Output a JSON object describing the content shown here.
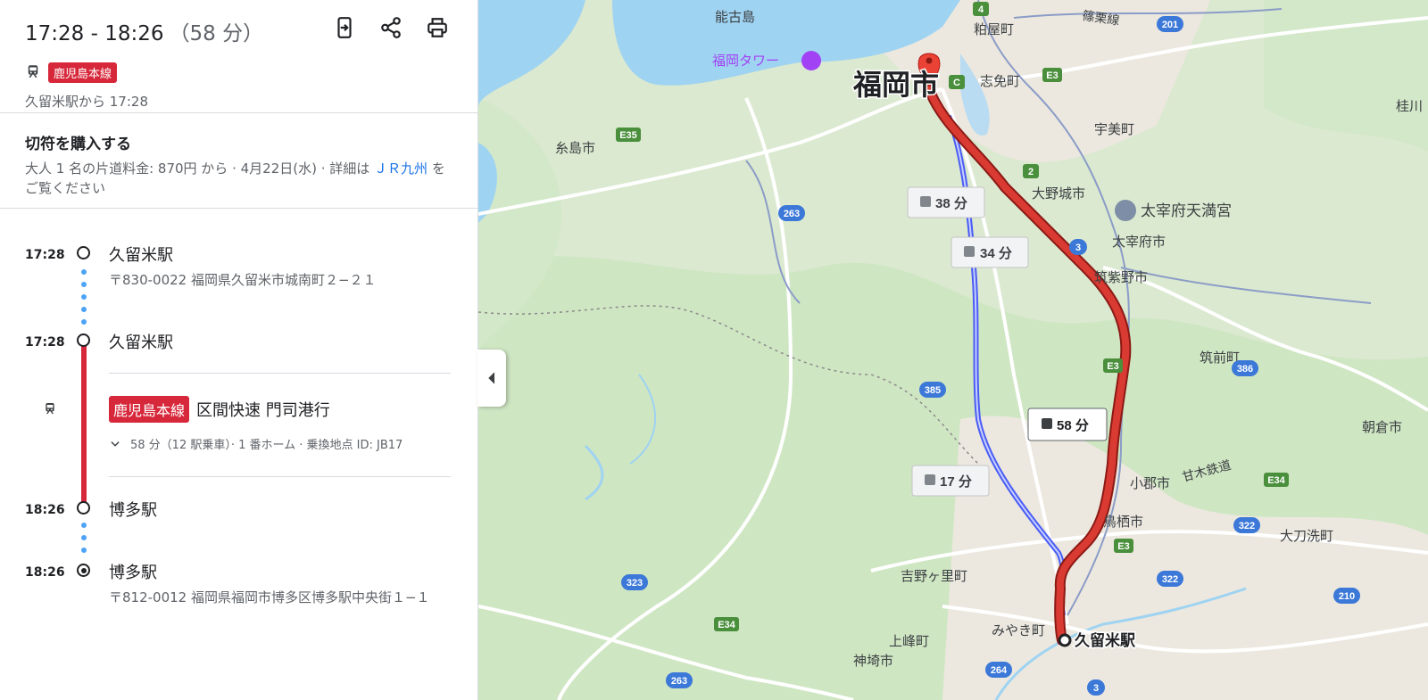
{
  "header": {
    "time_range": "17:28 - 18:26",
    "duration": "（58 分）",
    "line_badge": "鹿児島本線",
    "departure": "久留米駅から 17:28"
  },
  "ticket": {
    "title": "切符を購入する",
    "desc": "大人 1 名の片道料金: 870円 から · 4月22日(水) · 詳細は",
    "link": "ＪＲ九州",
    "desc_end": "をご覧ください"
  },
  "timeline": {
    "start_time": "17:28",
    "start_name": "久留米駅",
    "start_address": "〒830-0022 福岡県久留米市城南町２−２１",
    "board_time": "17:28",
    "board_name": "久留米駅",
    "line_badge": "鹿児島本線",
    "service": "区間快速 門司港行",
    "detail": "58 分（12 駅乗車）· 1 番ホーム · 乗換地点 ID: JB17",
    "alight_time": "18:26",
    "alight_name": "博多駅",
    "end_time": "18:26",
    "end_name": "博多駅",
    "end_address": "〒812-0012 福岡県福岡市博多区博多駅中央街１−１"
  },
  "map": {
    "places": {
      "nokonoshima": "能古島",
      "fukuoka_tower": "福岡タワー",
      "fukuoka_city": "福岡市",
      "kasuya": "粕屋町",
      "sasaguri": "篠栗線",
      "shime": "志免町",
      "umi": "宇美町",
      "itoshima": "糸島市",
      "onojo": "大野城市",
      "dazaifu_shrine": "太宰府天満宮",
      "dazaifu": "太宰府市",
      "chikushino": "筑紫野市",
      "katsura": "桂川",
      "chikuzen": "筑前町",
      "asakura": "朝倉市",
      "ogori": "小郡市",
      "amagi": "甘木鉄道",
      "tosu": "鳥栖市",
      "tachiarai": "大刀洗町",
      "yoshinogari": "吉野ヶ里町",
      "miyaki": "みやき町",
      "kurume_station": "久留米駅",
      "kamimine": "上峰町",
      "kanzaki": "神埼市"
    },
    "route_badges": [
      "38 分",
      "34 分",
      "58 分",
      "17 分"
    ],
    "road_shields": [
      "4",
      "201",
      "E3",
      "C",
      "E35",
      "2",
      "263",
      "3",
      "386",
      "E3",
      "385",
      "E34",
      "322",
      "E3",
      "322",
      "323",
      "E34",
      "210",
      "264",
      "263",
      "3"
    ],
    "colors": {
      "selected_route": "#c5221f",
      "alt_route": "#4a5cf5",
      "water": "#9fd3f2",
      "land": "#e6eedc"
    }
  }
}
